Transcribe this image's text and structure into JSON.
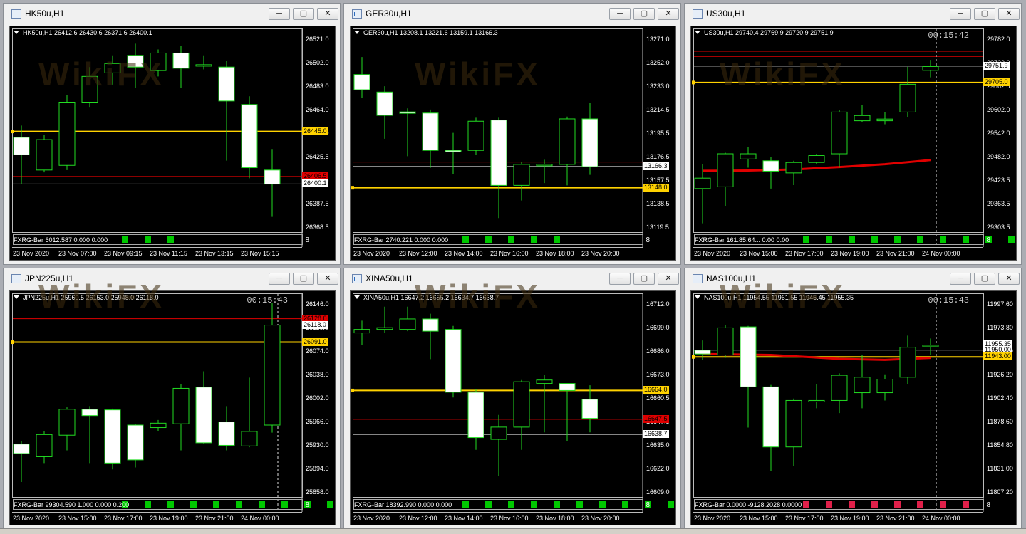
{
  "windows": [
    {
      "id": "hk50",
      "title": "HK50u,H1",
      "info": "HK50u,H1  26412.6 26430.6 26371.6 26400.1",
      "clock": "",
      "price_min": 26362.0,
      "price_max": 26527.5,
      "y_ticks": [
        "26521.0",
        "26502.0",
        "26483.0",
        "26464.0",
        "26445.0",
        "26425.5",
        "26406.5",
        "26387.5",
        "26368.5"
      ],
      "x_labels": [
        "23 Nov 2020",
        "23 Nov 07:00",
        "23 Nov 09:15",
        "23 Nov 11:15",
        "23 Nov 13:15",
        "23 Nov 15:15"
      ],
      "candles": [
        [
          26440,
          26425,
          26450,
          26400
        ],
        [
          26412,
          26438,
          26442,
          26410
        ],
        [
          26416,
          26470,
          26476,
          26412
        ],
        [
          26470,
          26492,
          26500,
          26466
        ],
        [
          26495,
          26503,
          26510,
          26485
        ],
        [
          26510,
          26500,
          26520,
          26482
        ],
        [
          26497,
          26512,
          26515,
          26492
        ],
        [
          26512,
          26499,
          26518,
          26482
        ],
        [
          26501,
          26502,
          26510,
          26498
        ],
        [
          26500,
          26471,
          26505,
          26420
        ],
        [
          26468,
          26414,
          26475,
          26405
        ],
        [
          26412,
          26400,
          26430,
          26372
        ]
      ],
      "hlines": [
        {
          "price": 26445.0,
          "color": "#ffd200",
          "label": "26445.0",
          "style": "yellow"
        },
        {
          "price": 26406.5,
          "color": "#e00000",
          "label": "26406.5",
          "style": "red"
        },
        {
          "price": 26400.1,
          "color": "#9a9a9a",
          "label": "26400.1",
          "style": "white"
        }
      ],
      "ma": [],
      "vline_index": null,
      "indicator": "FXRG-Bar 6012.587 0.000 0.000",
      "markers": [
        "#00c800",
        "#00c800",
        "#00c800"
      ]
    },
    {
      "id": "ger30",
      "title": "GER30u,H1",
      "info": "GER30u,H1  13208.1 13221.6 13159.1 13166.3",
      "clock": "",
      "price_min": 13113.0,
      "price_max": 13279.0,
      "y_ticks": [
        "13271.0",
        "13252.0",
        "13233.0",
        "13214.5",
        "13195.5",
        "13176.5",
        "13157.5",
        "13138.5",
        "13119.5"
      ],
      "x_labels": [
        "23 Nov 2020",
        "23 Nov 12:00",
        "23 Nov 14:00",
        "23 Nov 16:00",
        "23 Nov 18:00",
        "23 Nov 20:00"
      ],
      "candles": [
        [
          13245,
          13232,
          13260,
          13225
        ],
        [
          13230,
          13210,
          13235,
          13190
        ],
        [
          13213,
          13212,
          13216,
          13175
        ],
        [
          13212,
          13180,
          13215,
          13165
        ],
        [
          13180,
          13179,
          13195,
          13160
        ],
        [
          13180,
          13205,
          13208,
          13176
        ],
        [
          13206,
          13150,
          13208,
          13122
        ],
        [
          13150,
          13168,
          13170,
          13137
        ],
        [
          13167,
          13168,
          13172,
          13152
        ],
        [
          13168,
          13207,
          13209,
          13150
        ],
        [
          13207,
          13166,
          13221,
          13159
        ]
      ],
      "hlines": [
        {
          "price": 13170.0,
          "color": "#e00000",
          "label": "",
          "style": "none"
        },
        {
          "price": 13166.3,
          "color": "#9a9a9a",
          "label": "13166.3",
          "style": "white"
        },
        {
          "price": 13148.0,
          "color": "#ffd200",
          "label": "13148.0",
          "style": "yellow"
        }
      ],
      "ma": [],
      "vline_index": null,
      "indicator": "FXRG-Bar 2740.221 0.000 0.000",
      "markers": [
        "#00c800",
        "#00c800",
        "#00c800",
        "#00c800",
        "#00c800"
      ]
    },
    {
      "id": "us30",
      "title": "US30u,H1",
      "info": "US30u,H1  29740.4 29769.9 29720.9 29751.9",
      "clock": "00:15:42",
      "price_min": 29285.0,
      "price_max": 29842.0,
      "y_ticks": [
        "29782.0",
        "29722.0",
        "29662.0",
        "29602.0",
        "29542.0",
        "29482.0",
        "29423.5",
        "29363.5",
        "29303.5"
      ],
      "x_labels": [
        "23 Nov 2020",
        "23 Nov 15:00",
        "23 Nov 17:00",
        "23 Nov 19:00",
        "23 Nov 21:00",
        "24 Nov 00:00"
      ],
      "candles": [
        [
          29400,
          29430,
          29470,
          29300
        ],
        [
          29405,
          29500,
          29503,
          29350
        ],
        [
          29485,
          29500,
          29520,
          29460
        ],
        [
          29480,
          29450,
          29490,
          29400
        ],
        [
          29445,
          29475,
          29480,
          29410
        ],
        [
          29475,
          29495,
          29500,
          29470
        ],
        [
          29500,
          29620,
          29625,
          29460
        ],
        [
          29595,
          29610,
          29640,
          29590
        ],
        [
          29595,
          29600,
          29620,
          29585
        ],
        [
          29620,
          29700,
          29750,
          29605
        ],
        [
          29740,
          29751,
          29770,
          29720
        ]
      ],
      "hlines": [
        {
          "price": 29795.0,
          "color": "#e00000",
          "label": "",
          "style": "none"
        },
        {
          "price": 29780.0,
          "color": "#e00000",
          "label": "",
          "style": "none"
        },
        {
          "price": 29751.9,
          "color": "#9a9a9a",
          "label": "29751.9",
          "style": "white"
        },
        {
          "price": 29705.0,
          "color": "#ffd200",
          "label": "29705.0",
          "style": "yellow"
        }
      ],
      "ma": [
        [
          0,
          29451
        ],
        [
          2,
          29452
        ],
        [
          4,
          29455
        ],
        [
          6,
          29462
        ],
        [
          8,
          29470
        ],
        [
          10,
          29482
        ]
      ],
      "vline_index": 10,
      "indicator": "FXRG-Bar 161.85.64... 0.00 0.00",
      "markers": [
        "#00c800",
        "#00c800",
        "#00c800",
        "#00c800",
        "#00c800",
        "#00c800",
        "#00c800",
        "#00c800",
        "#00c800",
        "#00c800"
      ]
    },
    {
      "id": "jpn225",
      "title": "JPN225u,H1",
      "info": "JPN225u,H1  25960.5 26153.0 25948.0 26118.0",
      "clock": "00:15:43",
      "price_min": 25852.0,
      "price_max": 26158.0,
      "y_ticks": [
        "26146.0",
        "26110.0",
        "26074.0",
        "26038.0",
        "26002.0",
        "25966.0",
        "25930.0",
        "25894.0",
        "25858.0"
      ],
      "x_labels": [
        "23 Nov 2020",
        "23 Nov 15:00",
        "23 Nov 17:00",
        "23 Nov 19:00",
        "23 Nov 21:00",
        "24 Nov 00:00"
      ],
      "candles": [
        [
          25930,
          25915,
          25935,
          25870
        ],
        [
          25910,
          25945,
          25950,
          25900
        ],
        [
          25944,
          25985,
          25988,
          25920
        ],
        [
          25985,
          25975,
          25990,
          25900
        ],
        [
          25984,
          25900,
          25986,
          25890
        ],
        [
          25960,
          25905,
          25962,
          25893
        ],
        [
          25956,
          25963,
          25968,
          25950
        ],
        [
          25962,
          26018,
          26025,
          25920
        ],
        [
          26020,
          25932,
          26045,
          25930
        ],
        [
          25965,
          25928,
          25990,
          25920
        ],
        [
          25927,
          25950,
          26035,
          25925
        ],
        [
          25960,
          26118,
          26153,
          25948
        ]
      ],
      "hlines": [
        {
          "price": 26128.0,
          "color": "#e00000",
          "label": "26128.0",
          "style": "red"
        },
        {
          "price": 26118.0,
          "color": "#9a9a9a",
          "label": "26118.0",
          "style": "white"
        },
        {
          "price": 26091.0,
          "color": "#ffd200",
          "label": "26091.0",
          "style": "yellow"
        }
      ],
      "ma": [],
      "vline_index": 11,
      "indicator": "FXRG-Bar 99304.590 1.000 0.000 0.200",
      "markers": [
        "#00c800",
        "#00c800",
        "#00c800",
        "#00c800",
        "#00c800",
        "#00c800",
        "#00c800",
        "#00c800",
        "#00c800",
        "#00c800"
      ]
    },
    {
      "id": "xina50",
      "title": "XINA50u,H1",
      "info": "XINA50u,H1  16647.2 16655.2 16634.7 16638.7",
      "clock": "",
      "price_min": 16605.0,
      "price_max": 16716.0,
      "y_ticks": [
        "16712.0",
        "16699.0",
        "16686.0",
        "16673.0",
        "16660.5",
        "16647.5",
        "16635.0",
        "16622.0",
        "16609.0"
      ],
      "x_labels": [
        "23 Nov 2020",
        "23 Nov 12:00",
        "23 Nov 14:00",
        "23 Nov 16:00",
        "23 Nov 18:00",
        "23 Nov 20:00"
      ],
      "candles": [
        [
          16697,
          16699,
          16704,
          16690
        ],
        [
          16699,
          16700,
          16712,
          16697
        ],
        [
          16699,
          16705,
          16712,
          16698
        ],
        [
          16705,
          16698,
          16708,
          16682
        ],
        [
          16699,
          16663,
          16701,
          16660
        ],
        [
          16663,
          16637,
          16665,
          16630
        ],
        [
          16636,
          16643,
          16650,
          16615
        ],
        [
          16643,
          16669,
          16670,
          16630
        ],
        [
          16668,
          16670,
          16673,
          16640
        ],
        [
          16668,
          16664,
          16668,
          16635
        ],
        [
          16659,
          16648,
          16667,
          16640
        ]
      ],
      "hlines": [
        {
          "price": 16664.0,
          "color": "#ffd200",
          "label": "16664.0",
          "style": "yellow"
        },
        {
          "price": 16647.5,
          "color": "#e00000",
          "label": "16647.5",
          "style": "red"
        },
        {
          "price": 16638.7,
          "color": "#9a9a9a",
          "label": "16638.7",
          "style": "white"
        }
      ],
      "ma": [],
      "vline_index": null,
      "indicator": "FXRG-Bar 18392.990 0.000 0.000",
      "markers": [
        "#00c800",
        "#00c800",
        "#00c800",
        "#00c800",
        "#00c800",
        "#00c800",
        "#00c800",
        "#00c800",
        "#00c800",
        "#00c800",
        "#00c800",
        "#00c800"
      ]
    },
    {
      "id": "nas100",
      "title": "NAS100u,H1",
      "info": "NAS100u,H1  11954.55 11961.55 11945.45 11955.35",
      "clock": "00:15:43",
      "price_min": 11802.0,
      "price_max": 12002.0,
      "y_ticks": [
        "11997.60",
        "11973.80",
        "11950.00",
        "11926.20",
        "11902.40",
        "11878.60",
        "11854.80",
        "11831.00",
        "11807.20"
      ],
      "x_labels": [
        "23 Nov 2020",
        "23 Nov 15:00",
        "23 Nov 17:00",
        "23 Nov 19:00",
        "23 Nov 21:00",
        "24 Nov 00:00"
      ],
      "candles": [
        [
          11950,
          11946,
          11960,
          11940
        ],
        [
          11945,
          11973,
          11976,
          11942
        ],
        [
          11974,
          11912,
          11975,
          11870
        ],
        [
          11912,
          11850,
          11914,
          11825
        ],
        [
          11850,
          11898,
          11900,
          11830
        ],
        [
          11897,
          11898,
          11915,
          11890
        ],
        [
          11898,
          11924,
          11926,
          11885
        ],
        [
          11906,
          11922,
          11945,
          11890
        ],
        [
          11906,
          11920,
          11925,
          11898
        ],
        [
          11922,
          11953,
          11965,
          11915
        ],
        [
          11954,
          11955,
          11962,
          11945
        ]
      ],
      "hlines": [
        {
          "price": 11955.35,
          "color": "#9a9a9a",
          "label": "11955.35",
          "style": "white"
        },
        {
          "price": 11950.0,
          "color": "#aaaaaa",
          "label": "11950.00",
          "style": "white"
        },
        {
          "price": 11943.0,
          "color": "#ffd200",
          "label": "11943.00",
          "style": "yellow"
        }
      ],
      "ma": [
        [
          0,
          11946
        ],
        [
          3,
          11945
        ],
        [
          6,
          11941
        ],
        [
          8,
          11940
        ],
        [
          10,
          11942
        ]
      ],
      "vline_index": 10,
      "indicator": "FXRG-Bar 0.0000 -9128.2028 0.0000",
      "markers": [
        "#e0204a",
        "#e0204a",
        "#e0204a",
        "#e0204a",
        "#e0204a",
        "#e0204a",
        "#e0204a",
        "#e0204a"
      ]
    }
  ],
  "watermark_text": "WikiFX"
}
